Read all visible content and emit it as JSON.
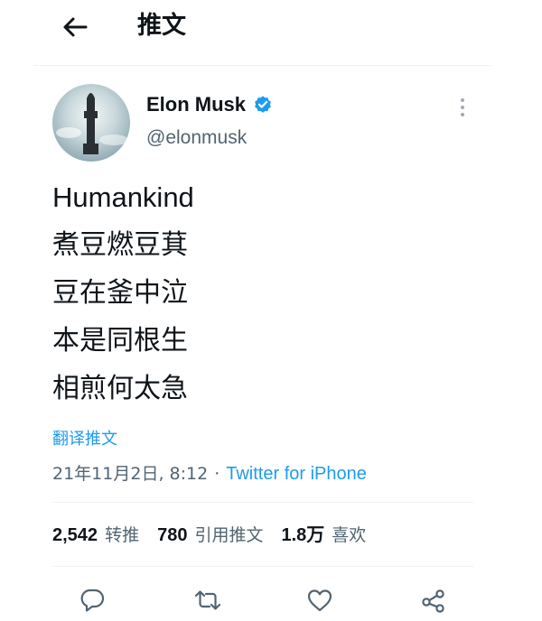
{
  "header": {
    "title": "推文",
    "back_icon": "arrow-left-icon"
  },
  "author": {
    "name": "Elon Musk",
    "handle": "@elonmusk",
    "verified_icon": "verified-badge-icon",
    "verified_color": "#1d9bf0"
  },
  "tweet": {
    "lines": [
      "Humankind",
      "煮豆燃豆萁",
      "豆在釜中泣",
      "本是同根生",
      "相煎何太急"
    ],
    "translate_label": "翻译推文",
    "timestamp": "21年11月2日, 8:12",
    "separator": "·",
    "source": "Twitter for iPhone"
  },
  "stats": [
    {
      "value": "2,542",
      "label": "转推"
    },
    {
      "value": "780",
      "label": "引用推文"
    },
    {
      "value": "1.8万",
      "label": "喜欢"
    }
  ],
  "actions": [
    {
      "icon": "reply-icon"
    },
    {
      "icon": "retweet-icon"
    },
    {
      "icon": "like-heart-icon"
    },
    {
      "icon": "share-icon"
    }
  ],
  "colors": {
    "accent": "#1d9bf0",
    "text": "#0f1419",
    "secondary": "#536471",
    "divider": "#eff3f4"
  }
}
